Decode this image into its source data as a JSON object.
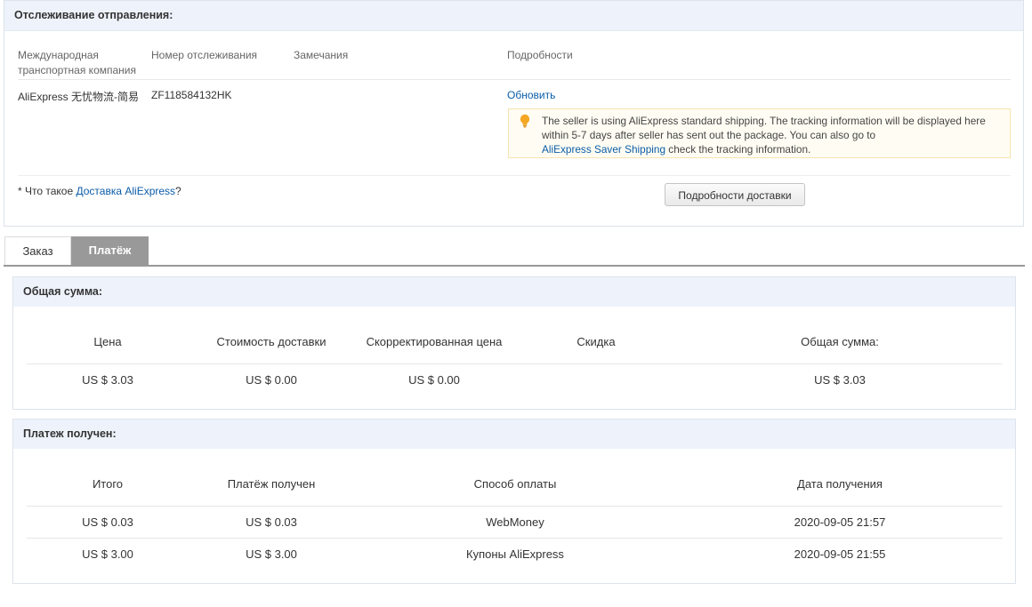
{
  "tracking": {
    "title": "Отслеживание отправления:",
    "columns": {
      "carrier": "Международная транспортная компания",
      "tracking_number": "Номер отслеживания",
      "remarks": "Замечания",
      "details": "Подробности"
    },
    "row": {
      "carrier": "AliExpress 无忧物流-简易",
      "tracking_number": "ZF118584132HK",
      "refresh": "Обновить"
    },
    "notice": {
      "line1": "The seller is using AliExpress standard shipping. The tracking information will be displayed here",
      "line2": "within 5-7 days after seller has sent out the package. You can also go to",
      "link": "AliExpress Saver Shipping",
      "line3_rest": " check the tracking information."
    },
    "footnote_prefix": "* Что такое ",
    "footnote_link": "Доставка AliExpress",
    "footnote_suffix": "?",
    "details_button": "Подробности доставки"
  },
  "tabs": [
    {
      "label": "Заказ",
      "active": false
    },
    {
      "label": "Платёж",
      "active": true
    }
  ],
  "total": {
    "title": "Общая сумма:",
    "headers": [
      "Цена",
      "Стоимость доставки",
      "Скорректированная цена",
      "Скидка",
      "Общая сумма:"
    ],
    "row": [
      "US $ 3.03",
      "US $ 0.00",
      "US $ 0.00",
      "",
      "US $ 3.03"
    ]
  },
  "payment": {
    "title": "Платеж получен:",
    "headers": [
      "Итого",
      "Платёж получен",
      "Способ оплаты",
      "Дата получения"
    ],
    "rows": [
      [
        "US $ 0.03",
        "US $ 0.03",
        "WebMoney",
        "2020-09-05 21:57"
      ],
      [
        "US $ 3.00",
        "US $ 3.00",
        "Купоны AliExpress",
        "2020-09-05 21:55"
      ]
    ]
  },
  "colors": {
    "header_bg": "#eef3fb",
    "link": "#0b5ca8",
    "active_tab": "#999999",
    "notice_bg": "#fffdf3",
    "bulb": "#f5a623"
  },
  "icons": [
    "lightbulb-icon"
  ]
}
